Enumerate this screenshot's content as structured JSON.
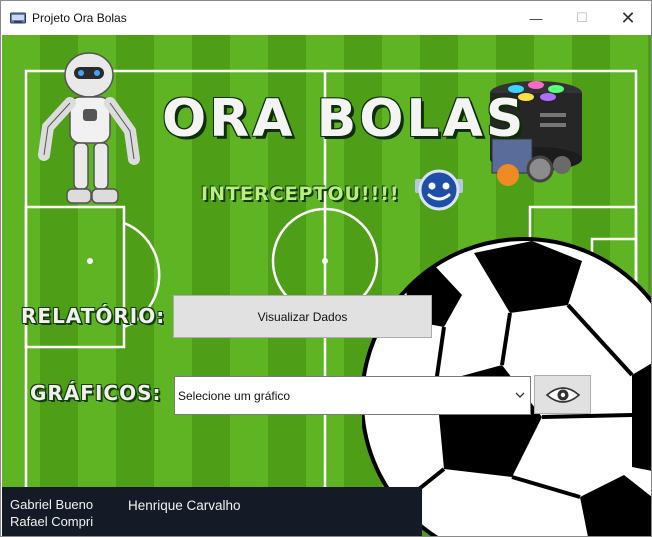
{
  "window": {
    "title": "Projeto Ora Bolas",
    "minimize_glyph": "—",
    "maximize_glyph": "☐",
    "close_glyph": "✕"
  },
  "banner": {
    "title": "ORA BOLAS",
    "subtitle": "INTERCEPTOU!!!!"
  },
  "report": {
    "label": "RELATÓRIO:",
    "button_label": "Visualizar Dados"
  },
  "charts": {
    "label": "GRÁFICOS:",
    "select_value": "Selecione um gráfico",
    "view_icon": "eye-icon"
  },
  "authors": {
    "first": "Gabriel Bueno",
    "second": "Rafael Compri",
    "third": "Henrique Carvalho"
  },
  "colors": {
    "field_green": "#52a51a",
    "footer_bar": "#141b26"
  }
}
